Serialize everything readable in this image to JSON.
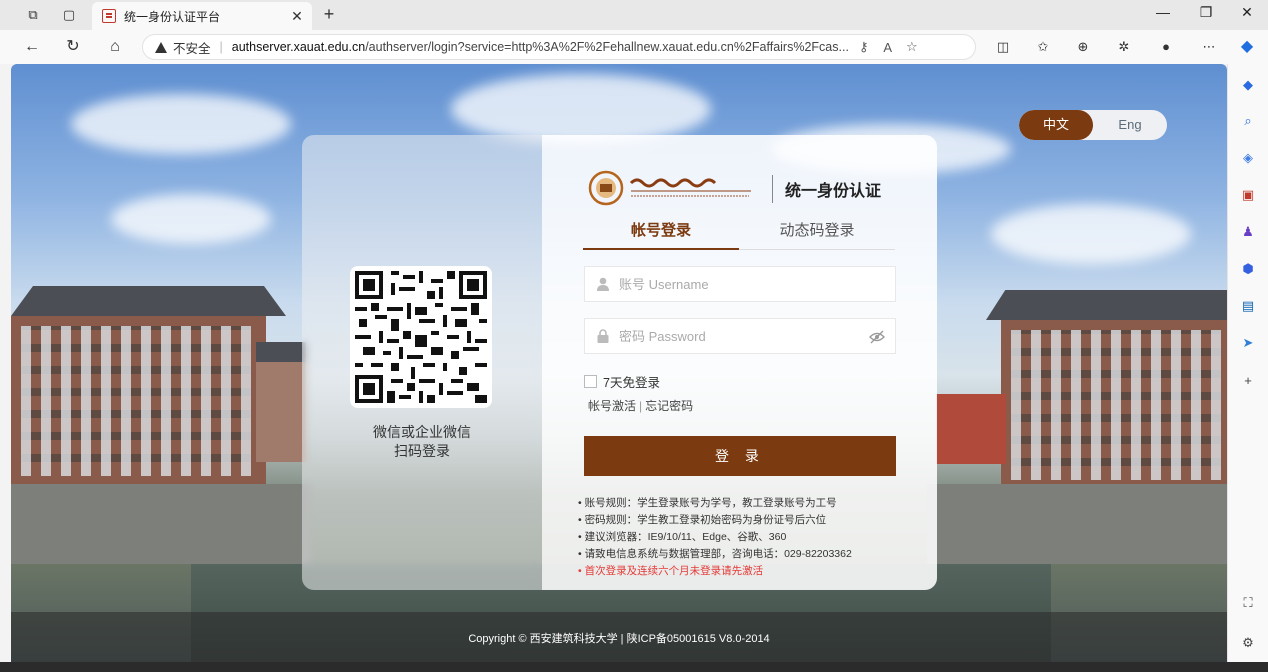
{
  "browser": {
    "tab_title": "统一身份认证平台",
    "security_label": "不安全",
    "url_host": "authserver.xauat.edu.cn",
    "url_rest": "/authserver/login?service=http%3A%2F%2Fehallnew.xauat.edu.cn%2Faffairs%2Fcas..."
  },
  "lang": {
    "zh": "中文",
    "en": "Eng"
  },
  "qr": {
    "caption_line1": "微信或企业微信",
    "caption_line2": "扫码登录"
  },
  "header": {
    "system_title": "统一身份认证"
  },
  "tabs": {
    "account": "帐号登录",
    "dynamic": "动态码登录"
  },
  "form": {
    "username_placeholder": "账号 Username",
    "password_placeholder": "密码 Password",
    "remember_label": "7天免登录",
    "activate_link": "帐号激活",
    "forgot_link": "忘记密码",
    "submit_label": "登 录"
  },
  "rules": [
    "账号规则：学生登录账号为学号，教工登录账号为工号",
    "密码规则：学生教工登录初始密码为身份证号后六位",
    "建议浏览器：IE9/10/11、Edge、谷歌、360",
    "请致电信息系统与数据管理部，咨询电话：029-82203362"
  ],
  "rules_warning": "首次登录及连续六个月未登录请先激活",
  "footer": {
    "copyright": "Copyright © 西安建筑科技大学 | 陕ICP备05001615 V8.0-2014"
  },
  "colors": {
    "brand": "#7b3a0f",
    "warning": "#e53935"
  }
}
